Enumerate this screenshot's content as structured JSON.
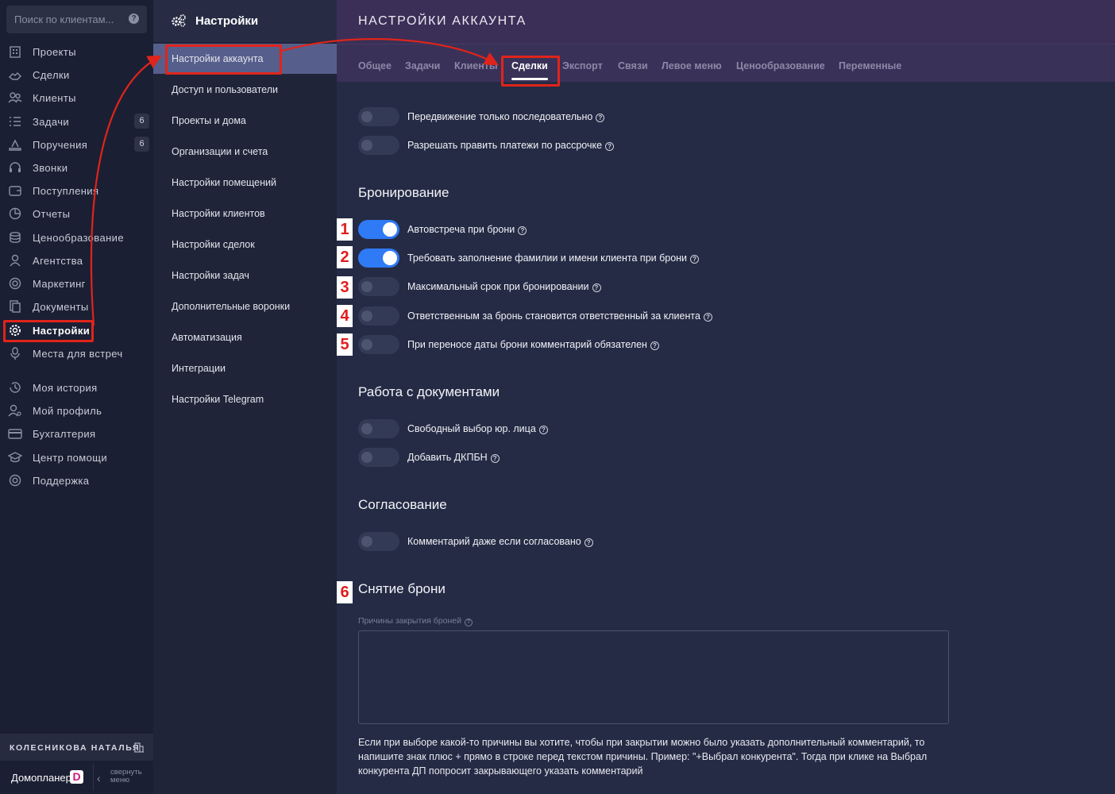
{
  "search": {
    "placeholder": "Поиск по клиентам...",
    "help_glyph": "?"
  },
  "nav": {
    "items": [
      {
        "label": "Проекты",
        "icon": "building-icon"
      },
      {
        "label": "Сделки",
        "icon": "handshake-icon"
      },
      {
        "label": "Клиенты",
        "icon": "users-icon"
      },
      {
        "label": "Задачи",
        "icon": "tasks-icon",
        "badge": "6"
      },
      {
        "label": "Поручения",
        "icon": "assignment-icon",
        "badge": "6"
      },
      {
        "label": "Звонки",
        "icon": "headset-icon"
      },
      {
        "label": "Поступления",
        "icon": "wallet-icon"
      },
      {
        "label": "Отчеты",
        "icon": "pie-chart-icon"
      },
      {
        "label": "Ценообразование",
        "icon": "coins-icon"
      },
      {
        "label": "Агентства",
        "icon": "agent-icon"
      },
      {
        "label": "Маркетинг",
        "icon": "target-icon"
      },
      {
        "label": "Документы",
        "icon": "documents-icon"
      },
      {
        "label": "Настройки",
        "icon": "gear-icon",
        "active": true
      },
      {
        "label": "Места для встреч",
        "icon": "meeting-point-icon"
      },
      {
        "label": "Моя история",
        "icon": "history-icon"
      },
      {
        "label": "Мой профиль",
        "icon": "profile-icon"
      },
      {
        "label": "Бухгалтерия",
        "icon": "card-icon"
      },
      {
        "label": "Центр помощи",
        "icon": "graduation-icon"
      },
      {
        "label": "Поддержка",
        "icon": "lifebuoy-icon"
      }
    ]
  },
  "user": {
    "name": "КОЛЕСНИКОВА НАТАЛЬЯ"
  },
  "brand": {
    "name": "Домопланер",
    "logo_letter": "D",
    "collapse_label": "свернуть меню",
    "collapse_glyph": "‹"
  },
  "submenu": {
    "title": "Настройки",
    "items": [
      "Настройки аккаунта",
      "Доступ и пользователи",
      "Проекты и дома",
      "Организации и счета",
      "Настройки помещений",
      "Настройки клиентов",
      "Настройки сделок",
      "Настройки задач",
      "Дополнительные воронки",
      "Автоматизация",
      "Интеграции",
      "Настройки Telegram"
    ]
  },
  "main": {
    "title": "НАСТРОЙКИ АККАУНТА",
    "tabs": [
      "Общее",
      "Задачи",
      "Клиенты",
      "Сделки",
      "Экспорт",
      "Связи",
      "Левое меню",
      "Ценообразование",
      "Переменные"
    ],
    "help_glyph": "?",
    "general_options": [
      {
        "label": "Передвижение только последовательно",
        "on": false
      },
      {
        "label": "Разрешать править платежи по рассрочке",
        "on": false
      }
    ],
    "booking": {
      "title": "Бронирование",
      "options": [
        {
          "label": "Автовстреча при брони",
          "on": true,
          "marker": "1"
        },
        {
          "label": "Требовать заполнение фамилии и имени клиента при брони",
          "on": true,
          "marker": "2"
        },
        {
          "label": "Максимальный срок при бронировании",
          "on": false,
          "marker": "3"
        },
        {
          "label": "Ответственным за бронь становится ответственный за клиента",
          "on": false,
          "marker": "4"
        },
        {
          "label": "При переносе даты брони комментарий обязателен",
          "on": false,
          "marker": "5"
        }
      ]
    },
    "documents": {
      "title": "Работа с документами",
      "options": [
        {
          "label": "Свободный выбор юр. лица",
          "on": false
        },
        {
          "label": "Добавить ДКПБН",
          "on": false
        }
      ]
    },
    "approval": {
      "title": "Согласование",
      "options": [
        {
          "label": "Комментарий даже если согласовано",
          "on": false
        }
      ]
    },
    "unbooking": {
      "title": "Снятие брони",
      "marker": "6",
      "reasons_label": "Причины закрытия броней",
      "reasons_value": "",
      "hint": "Если при выборе какой-то причины вы хотите, чтобы при закрытии можно было указать дополнительный комментарий, то напишите знак плюс + прямо в строке перед текстом причины. Пример: \"+Выбрал конкурента\". Тогда при клике на Выбрал конкурента ДП попросит закрывающего указать комментарий"
    }
  },
  "colors": {
    "accent": "#2f7af5",
    "annotation": "#e0241b",
    "nav_bg": "#1b1f33",
    "main_bg": "#252b45",
    "header_bg": "#3b2f57"
  }
}
